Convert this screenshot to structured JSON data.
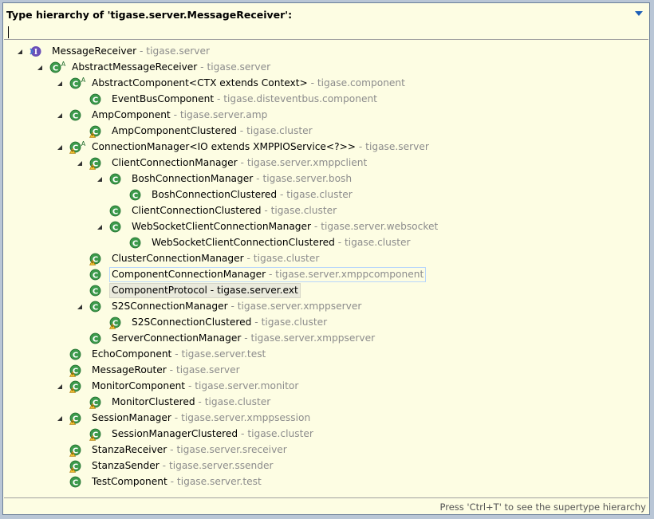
{
  "title": "Type hierarchy of 'tigase.server.MessageReceiver':",
  "filter": {
    "value": ""
  },
  "status": "Press 'Ctrl+T' to see the supertype hierarchy",
  "colors": {
    "class_icon": "#3c9a4b",
    "interface_icon": "#6a4fb8",
    "background": "#fdfde3"
  },
  "tree": [
    {
      "depth": 0,
      "name": "MessageReceiver",
      "pkg": "tigase.server",
      "icon": "interface",
      "expanded": true
    },
    {
      "depth": 1,
      "name": "AbstractMessageReceiver",
      "pkg": "tigase.server",
      "icon": "class-abstract",
      "expanded": true
    },
    {
      "depth": 2,
      "name": "AbstractComponent<CTX extends Context>",
      "pkg": "tigase.component",
      "icon": "class-abstract",
      "expanded": true
    },
    {
      "depth": 3,
      "name": "EventBusComponent",
      "pkg": "tigase.disteventbus.component",
      "icon": "class"
    },
    {
      "depth": 2,
      "name": "AmpComponent",
      "pkg": "tigase.server.amp",
      "icon": "class",
      "expanded": true
    },
    {
      "depth": 3,
      "name": "AmpComponentClustered",
      "pkg": "tigase.cluster",
      "icon": "class-warning"
    },
    {
      "depth": 2,
      "name": "ConnectionManager<IO extends XMPPIOService<?>>",
      "pkg": "tigase.server",
      "icon": "class-abstract-warning",
      "expanded": true
    },
    {
      "depth": 3,
      "name": "ClientConnectionManager",
      "pkg": "tigase.server.xmppclient",
      "icon": "class-warning",
      "expanded": true
    },
    {
      "depth": 4,
      "name": "BoshConnectionManager",
      "pkg": "tigase.server.bosh",
      "icon": "class",
      "expanded": true
    },
    {
      "depth": 5,
      "name": "BoshConnectionClustered",
      "pkg": "tigase.cluster",
      "icon": "class"
    },
    {
      "depth": 4,
      "name": "ClientConnectionClustered",
      "pkg": "tigase.cluster",
      "icon": "class"
    },
    {
      "depth": 4,
      "name": "WebSocketClientConnectionManager",
      "pkg": "tigase.server.websocket",
      "icon": "class",
      "expanded": true
    },
    {
      "depth": 5,
      "name": "WebSocketClientConnectionClustered",
      "pkg": "tigase.cluster",
      "icon": "class"
    },
    {
      "depth": 3,
      "name": "ClusterConnectionManager",
      "pkg": "tigase.cluster",
      "icon": "class-warning"
    },
    {
      "depth": 3,
      "name": "ComponentConnectionManager",
      "pkg": "tigase.server.xmppcomponent",
      "icon": "class",
      "state": "hover"
    },
    {
      "depth": 3,
      "name": "ComponentProtocol",
      "pkg": "tigase.server.ext",
      "icon": "class",
      "state": "selected"
    },
    {
      "depth": 3,
      "name": "S2SConnectionManager",
      "pkg": "tigase.server.xmppserver",
      "icon": "class",
      "expanded": true
    },
    {
      "depth": 4,
      "name": "S2SConnectionClustered",
      "pkg": "tigase.cluster",
      "icon": "class-warning"
    },
    {
      "depth": 3,
      "name": "ServerConnectionManager",
      "pkg": "tigase.server.xmppserver",
      "icon": "class"
    },
    {
      "depth": 2,
      "name": "EchoComponent",
      "pkg": "tigase.server.test",
      "icon": "class"
    },
    {
      "depth": 2,
      "name": "MessageRouter",
      "pkg": "tigase.server",
      "icon": "class-warning"
    },
    {
      "depth": 2,
      "name": "MonitorComponent",
      "pkg": "tigase.server.monitor",
      "icon": "class-warning",
      "expanded": true
    },
    {
      "depth": 3,
      "name": "MonitorClustered",
      "pkg": "tigase.cluster",
      "icon": "class-warning"
    },
    {
      "depth": 2,
      "name": "SessionManager",
      "pkg": "tigase.server.xmppsession",
      "icon": "class-warning",
      "expanded": true
    },
    {
      "depth": 3,
      "name": "SessionManagerClustered",
      "pkg": "tigase.cluster",
      "icon": "class-warning"
    },
    {
      "depth": 2,
      "name": "StanzaReceiver",
      "pkg": "tigase.server.sreceiver",
      "icon": "class-warning"
    },
    {
      "depth": 2,
      "name": "StanzaSender",
      "pkg": "tigase.server.ssender",
      "icon": "class-warning"
    },
    {
      "depth": 2,
      "name": "TestComponent",
      "pkg": "tigase.server.test",
      "icon": "class"
    }
  ]
}
